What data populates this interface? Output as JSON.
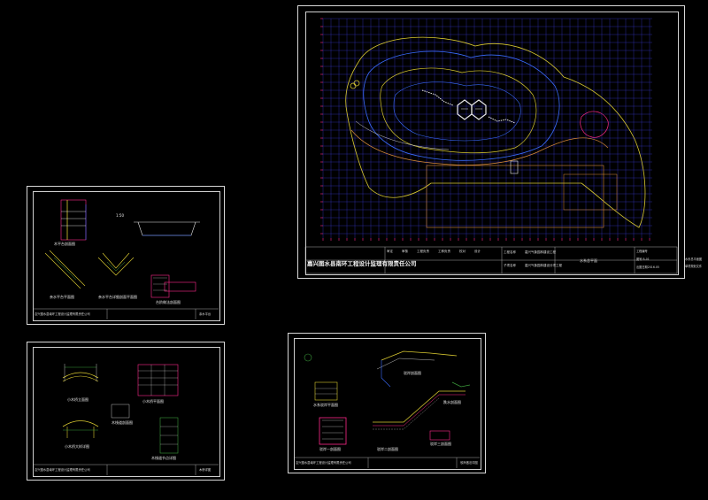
{
  "main_sheet": {
    "company": "嘉兴图水县南环工程设计监理有限责任公司",
    "columns": [
      "审定",
      "审核",
      "工程负责",
      "工种负责",
      "校对",
      "设计"
    ],
    "project_label": "工程名称",
    "project_name": "嘉兴气象园林建设工程",
    "sub_project_label": "子项名称",
    "sub_project_name": "嘉兴气象园林建设分项工程",
    "drawing_title": "水系总平面",
    "right_labels": [
      "工程编号",
      "图号  B-01",
      "出图日期2016.05"
    ],
    "right_side_notes": [
      "水系总平面图",
      "单项规划文件"
    ]
  },
  "sheet_a": {
    "company": "嘉兴图水县南环工程设计监理有限责任公司",
    "labels": [
      "木平台剖面图",
      "亲水平台平面图",
      "亲水平台详细剖面平面图",
      "台阶做法剖面图"
    ],
    "drawing_name": "亲水平台",
    "small_note": "1:50"
  },
  "sheet_b": {
    "company": "嘉兴图水县南环工程设计监理有限责任公司",
    "labels": [
      "小木桥立面图",
      "小木桥平面图",
      "木栈道剖面图",
      "小木桥大样详图",
      "木栈道节点详图"
    ],
    "drawing_name": "木桥详图"
  },
  "sheet_c": {
    "company": "嘉兴图水县南环工程设计监理有限责任公司",
    "labels": [
      "驳岸剖面图",
      "水系驳岸平面图",
      "驳岸一剖面图",
      "驳岸二剖面图",
      "驳岸三剖面图",
      "跌水剖面图"
    ],
    "drawing_name": "驳岸做法详图"
  },
  "colors": {
    "grid": "#3a3ad8",
    "grid_accent": "#ff2a8a",
    "contour_yellow": "#d8c830",
    "contour_blue": "#3a6cff",
    "contour_orange": "#d88a3a",
    "border": "#d8d8d8"
  }
}
